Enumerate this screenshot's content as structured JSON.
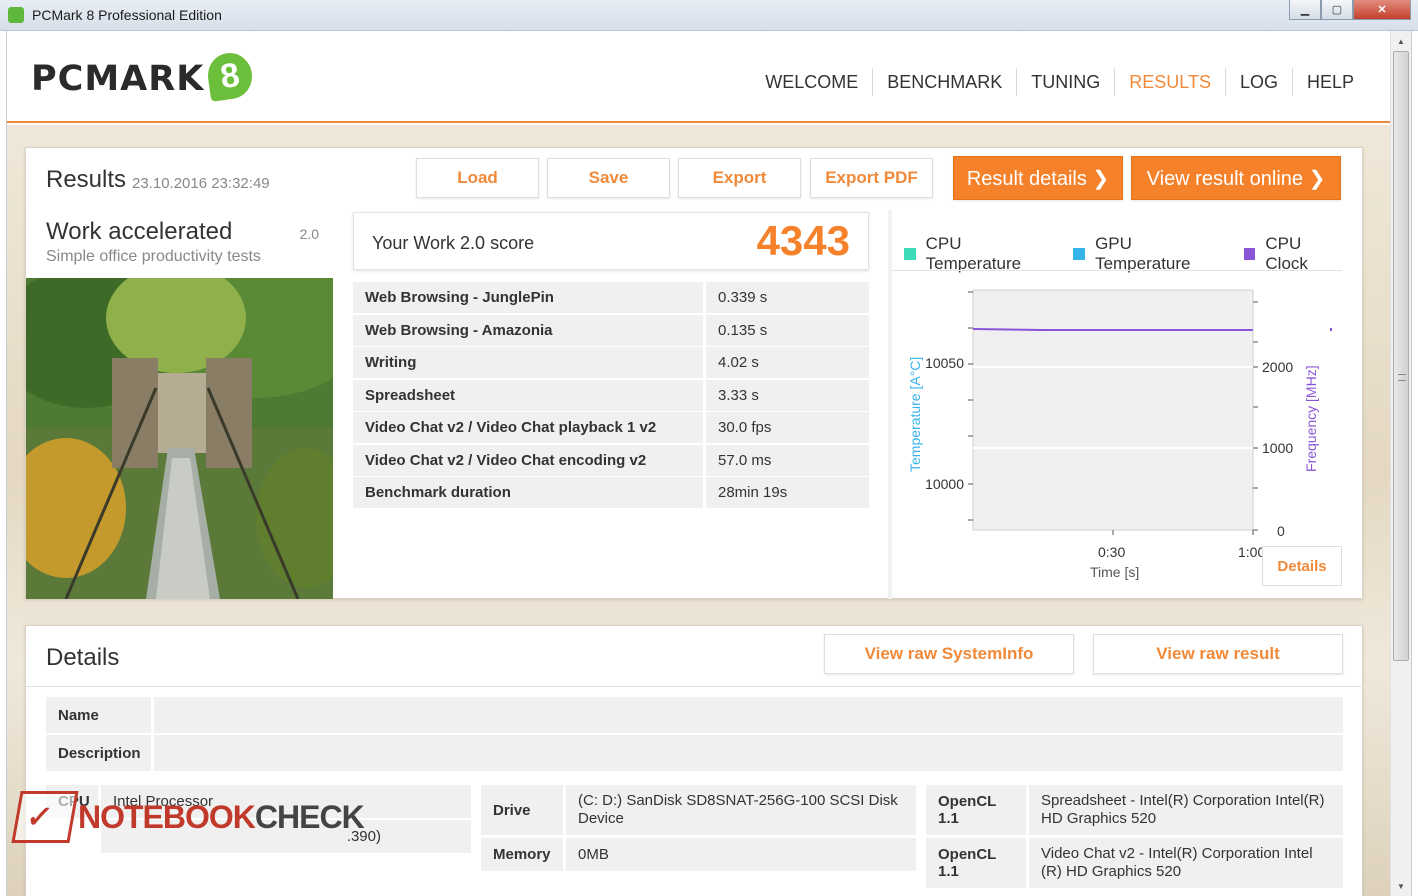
{
  "window": {
    "title": "PCMark 8 Professional Edition",
    "buttons": [
      "▁",
      "▢",
      "✕"
    ]
  },
  "header": {
    "logo_text": "PCMARK",
    "logo_digit": "8",
    "nav": [
      {
        "label": "WELCOME",
        "active": false
      },
      {
        "label": "BENCHMARK",
        "active": false
      },
      {
        "label": "TUNING",
        "active": false
      },
      {
        "label": "RESULTS",
        "active": true
      },
      {
        "label": "LOG",
        "active": false
      },
      {
        "label": "HELP",
        "active": false
      }
    ]
  },
  "results": {
    "title": "Results",
    "timestamp": "23.10.2016 23:32:49",
    "buttons": {
      "load": "Load",
      "save": "Save",
      "export": "Export",
      "export_pdf": "Export PDF",
      "result_details": "Result details ❯",
      "view_online": "View result online ❯"
    },
    "test": {
      "name": "Work accelerated",
      "version": "2.0",
      "subtitle": "Simple office productivity tests"
    },
    "score": {
      "label": "Your Work 2.0 score",
      "value": "4343"
    },
    "rows": [
      {
        "name": "Web Browsing - JunglePin",
        "value": "0.339 s"
      },
      {
        "name": "Web Browsing - Amazonia",
        "value": "0.135 s"
      },
      {
        "name": "Writing",
        "value": "4.02 s"
      },
      {
        "name": "Spreadsheet",
        "value": "3.33 s"
      },
      {
        "name": "Video Chat v2 / Video Chat playback 1 v2",
        "value": "30.0 fps"
      },
      {
        "name": "Video Chat v2 / Video Chat encoding v2",
        "value": "57.0 ms"
      },
      {
        "name": "Benchmark duration",
        "value": "28min 19s"
      }
    ],
    "chart": {
      "legend": [
        {
          "name": "CPU Temperature",
          "color": "#3ddbb8"
        },
        {
          "name": "GPU Temperature",
          "color": "#36b4ea"
        },
        {
          "name": "CPU Clock",
          "color": "#8b55d8"
        }
      ],
      "left_axis_label": "Temperature [A°C]",
      "right_axis_label": "Frequency [MHz]",
      "x_axis_label": "Time [s]",
      "left_ticks": [
        "10050",
        "10000"
      ],
      "right_ticks": [
        "2000",
        "1000",
        "0"
      ],
      "x_ticks": [
        "0:30",
        "1:00"
      ],
      "details_label": "Details"
    }
  },
  "details": {
    "title": "Details",
    "buttons": {
      "raw_sysinfo": "View raw SystemInfo",
      "raw_result": "View raw result"
    },
    "name_label": "Name",
    "name_value": "",
    "description_label": "Description",
    "description_value": "",
    "cpu_label": "CPU",
    "cpu_value": "Intel Processor",
    "cpu_extra": ".390)",
    "drive_label": "Drive",
    "drive_value": "(C: D:) SanDisk SD8SNAT-256G-100 SCSI Disk Device",
    "memory_label": "Memory",
    "memory_value": "0MB",
    "opencl1_label": "OpenCL 1.1",
    "opencl1_value": "Spreadsheet - Intel(R) Corporation Intel(R) HD Graphics 520",
    "opencl2_label": "OpenCL 1.1",
    "opencl2_value": "Video Chat v2 - Intel(R) Corporation Intel (R) HD Graphics 520"
  },
  "watermark": {
    "part1": "NOTEBOOK",
    "part2": "CHECK"
  }
}
